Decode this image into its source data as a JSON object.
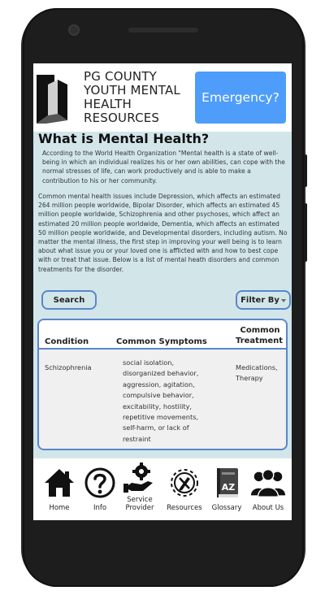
{
  "header": {
    "org_name_line1": "PG COUNTY",
    "org_name_line2": "YOUTH MENTAL",
    "org_name_line3": "HEALTH",
    "org_name_line4": "RESOURCES",
    "emergency_label": "Emergency?"
  },
  "main": {
    "title": "What is Mental Health?",
    "quote": "According to the World Health Organization \"Mental health is a state of well-being in which an individual realizes his or her own abilities, can cope with the normal stresses of life, can work productively and is able to make a contribution to his or her community.",
    "body": "Common mental health issues include Depression, which affects an estimated 264 million people worldwide, Bipolar Disorder, which affects an estimated 45 million people worldwide, Schizophrenia and other psychoses, which affect an estimated 20 million people worldwide, Dementia, which affects an estimated 50 million people worldwide, and Developmental disorders, including autism. No matter the mental illness, the first step in improving your well being is to learn about what issue you or your loved one is afflicted with and how to best cope with or treat that issue. Below is a list of mental heath disorders and common treatments for the disorder.",
    "search_label": "Search",
    "filter_label": "Filter By"
  },
  "table": {
    "headers": {
      "condition": "Condition",
      "symptoms": "Common Symptoms",
      "treatment_line1": "Common",
      "treatment_line2": "Treatment"
    },
    "rows": [
      {
        "condition": "Schizophrenia",
        "symptoms": [
          "social isolation,",
          "disorganized behavior,",
          "aggression, agitation,",
          "compulsive behavior,",
          "excitability, hostility,",
          "repetitive movements,",
          "self-harm, or lack of",
          "restraint"
        ],
        "treatment": [
          "Medications,",
          "Therapy"
        ]
      }
    ]
  },
  "nav": {
    "items": [
      {
        "label": "Home",
        "icon": "home-icon"
      },
      {
        "label": "Info",
        "icon": "question-icon"
      },
      {
        "label_line1": "Service",
        "label_line2": "Provider",
        "icon": "service-provider-icon"
      },
      {
        "label": "Resources",
        "icon": "resources-gear-icon"
      },
      {
        "label": "Glossary",
        "icon": "glossary-book-icon"
      },
      {
        "label": "About Us",
        "icon": "people-icon"
      }
    ]
  },
  "colors": {
    "accent": "#4e9dfa",
    "content_bg": "#d2e6ea",
    "border": "#5a86c9"
  }
}
